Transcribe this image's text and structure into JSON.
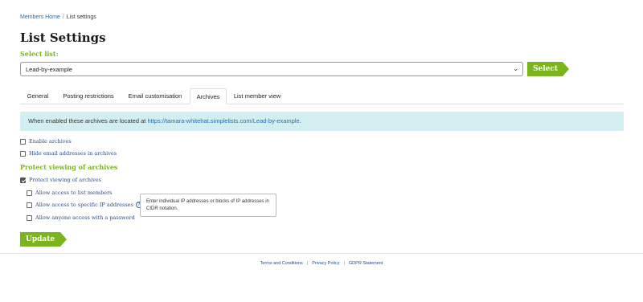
{
  "breadcrumb": {
    "home": "Members Home",
    "separator": "/",
    "current": "List settings"
  },
  "page_title": "List Settings",
  "select_list": {
    "label": "Select list:",
    "value": "Lead-by-example",
    "button": "Select"
  },
  "tabs": [
    {
      "label": "General",
      "active": false
    },
    {
      "label": "Posting restrictions",
      "active": false
    },
    {
      "label": "Email customisation",
      "active": false
    },
    {
      "label": "Archives",
      "active": true
    },
    {
      "label": "List member view",
      "active": false
    }
  ],
  "info": {
    "prefix": "When enabled these archives are located at ",
    "link": "https://tamara-whitehat.simplelists.com/Lead-by-example",
    "suffix": "."
  },
  "options": {
    "enable_archives": {
      "label": "Enable archives",
      "checked": false
    },
    "hide_emails": {
      "label": "Hide email addresses in archives",
      "checked": false
    }
  },
  "protect": {
    "heading": "Protect viewing of archives",
    "protect_viewing": {
      "label": "Protect viewing of archives",
      "checked": true
    },
    "allow_members": {
      "label": "Allow access to list members",
      "checked": false
    },
    "allow_ips": {
      "label": "Allow access to specific IP addresses",
      "checked": false
    },
    "allow_password": {
      "label": "Allow anyone access with a password",
      "checked": false
    }
  },
  "tooltip": "Enter individual IP addresses or blocks of IP addresses in CIDR notation.",
  "update_button": "Update",
  "footer": {
    "terms": "Terms and Conditions",
    "privacy": "Privacy Policy",
    "gdpr": "GDPR Statement",
    "separator": "|"
  },
  "colors": {
    "accent": "#7ab51d",
    "info_bg": "#d3eef0",
    "link": "#2a6db0"
  }
}
